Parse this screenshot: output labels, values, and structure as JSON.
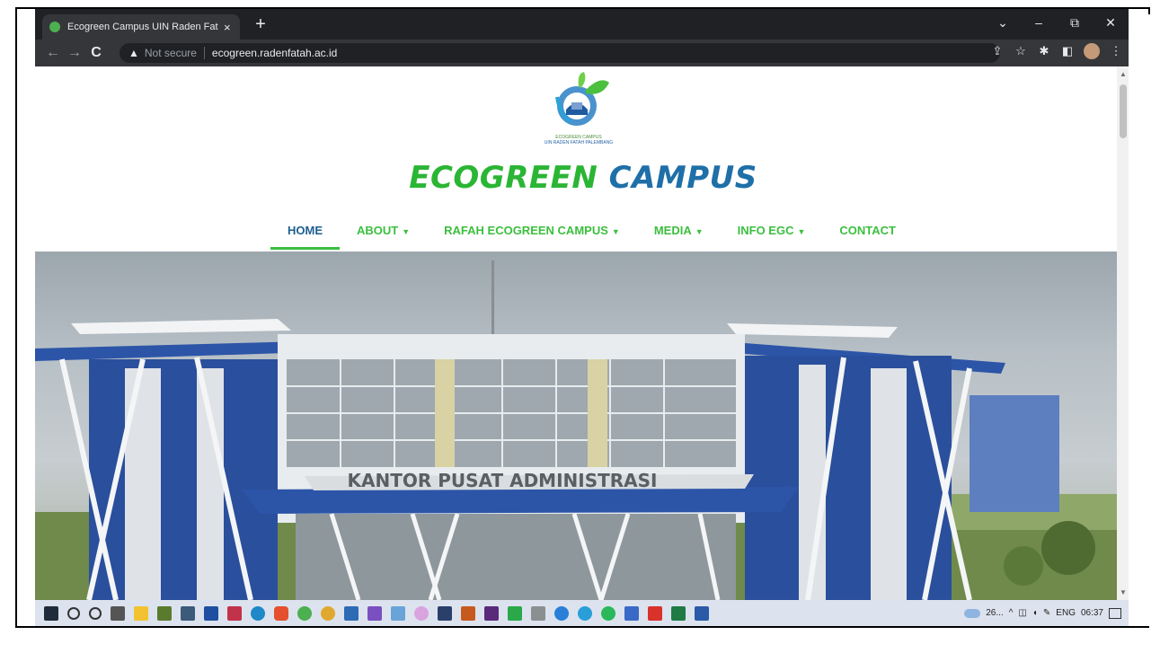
{
  "browser": {
    "tab_title": "Ecogreen Campus UIN Raden Fat",
    "tab_close": "×",
    "new_tab": "+",
    "window_controls": {
      "dropdown": "⌄",
      "minimize": "–",
      "restore": "⧉",
      "close": "✕"
    },
    "nav": {
      "back": "←",
      "forward": "→",
      "reload": "C"
    },
    "security_icon": "▲",
    "security_label": "Not secure",
    "url": "ecogreen.radenfatah.ac.id",
    "toolbar_icons": [
      "share-icon",
      "star-icon",
      "extensions-icon",
      "sidepanel-icon",
      "avatar-icon",
      "menu-icon"
    ],
    "toolbar_glyphs": {
      "share": "⇪",
      "star": "☆",
      "extensions": "✱",
      "sidepanel": "◧",
      "menu": "⋮"
    }
  },
  "site": {
    "logo_caption_1": "ECOGREEN CAMPUS",
    "logo_caption_2": "UIN RADEN FATAH PALEMBANG",
    "title_part1": "ECOGREEN",
    "title_part2": "CAMPUS",
    "colors": {
      "green": "#2bb534",
      "blue": "#1f6fa8",
      "menu_green": "#3bbf3e",
      "menu_active": "#1d5f8f"
    },
    "menu": [
      {
        "label": "HOME",
        "active": true,
        "dropdown": false
      },
      {
        "label": "ABOUT",
        "active": false,
        "dropdown": true
      },
      {
        "label": "RAFAH ECOGREEN CAMPUS",
        "active": false,
        "dropdown": true
      },
      {
        "label": "MEDIA",
        "active": false,
        "dropdown": true
      },
      {
        "label": "INFO EGC",
        "active": false,
        "dropdown": true
      },
      {
        "label": "CONTACT",
        "active": false,
        "dropdown": false
      }
    ],
    "caret": "▼",
    "hero_sign": "KANTOR PUSAT ADMINISTRASI"
  },
  "taskbar": {
    "weather": "26...",
    "tray_chevron": "^",
    "language": "ENG",
    "time": "06:37",
    "icons": [
      "windows-start-icon",
      "search-icon",
      "cortana-icon",
      "task-view-icon",
      "file-explorer-icon",
      "minecraft-icon",
      "app-icon",
      "app-icon",
      "edge-icon",
      "brave-icon",
      "chrome-icon",
      "chrome-canary-icon",
      "app-icon",
      "visual-studio-icon",
      "notepad-icon",
      "paint-icon",
      "app-icon",
      "illustrator-icon",
      "premiere-icon",
      "app-icon",
      "app-icon",
      "app-icon",
      "app-icon",
      "app-icon",
      "app-icon",
      "acrobat-icon",
      "excel-icon",
      "word-icon"
    ]
  }
}
